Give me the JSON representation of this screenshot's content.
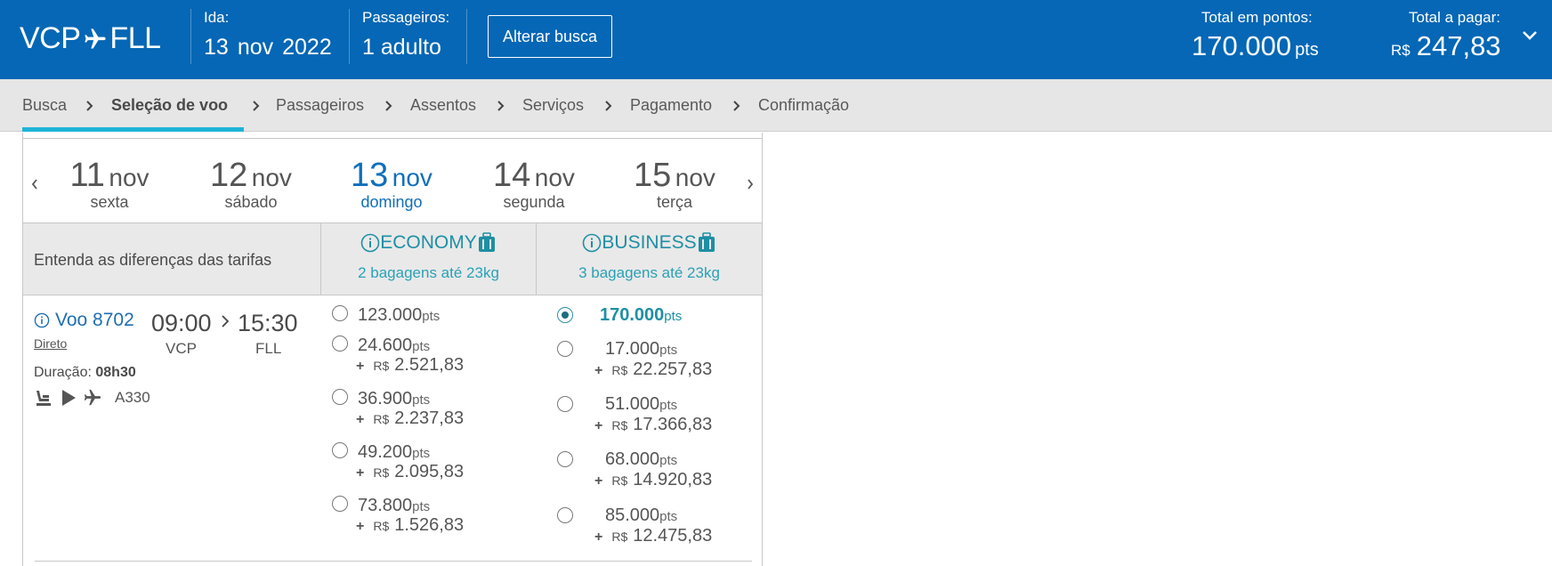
{
  "header": {
    "route_from": "VCP",
    "route_to": "FLL",
    "ida_label": "Ida:",
    "ida_day": "13",
    "ida_month": "nov",
    "ida_year": "2022",
    "passengers_label": "Passageiros:",
    "passengers_value": "1 adulto",
    "change_button": "Alterar busca",
    "total_points_label": "Total em pontos:",
    "total_points_value": "170.000",
    "total_points_unit": "pts",
    "total_pay_label": "Total a pagar:",
    "total_pay_currency": "R$",
    "total_pay_value": "247,83",
    "brand_color": "#0567b5"
  },
  "breadcrumb": {
    "steps": [
      "Busca",
      "Seleção de voo",
      "Passageiros",
      "Assentos",
      "Serviços",
      "Pagamento",
      "Confirmação"
    ],
    "active_step": "Seleção de voo"
  },
  "dates": [
    {
      "day": "11",
      "month": "nov",
      "weekday": "sexta"
    },
    {
      "day": "12",
      "month": "nov",
      "weekday": "sábado"
    },
    {
      "day": "13",
      "month": "nov",
      "weekday": "domingo",
      "selected": true
    },
    {
      "day": "14",
      "month": "nov",
      "weekday": "segunda"
    },
    {
      "day": "15",
      "month": "nov",
      "weekday": "terça"
    }
  ],
  "fare_header": {
    "differences_text": "Entenda as diferenças das tarifas",
    "economy_name": "ECONOMY",
    "economy_bags": "2 bagagens até 23kg",
    "business_name": "BUSINESS",
    "business_bags": "3 bagagens até 23kg"
  },
  "flight": {
    "number": "Voo 8702",
    "type": "Direto",
    "depart_time": "09:00",
    "arrive_time": "15:30",
    "origin": "VCP",
    "destination": "FLL",
    "duration_label": "Duração:",
    "duration_value": "08h30",
    "aircraft": "A330",
    "amenity_icons": [
      "seat-icon",
      "play-icon",
      "plane-icon"
    ]
  },
  "economy_options": [
    {
      "points": "123.000",
      "unit": "pts",
      "money": null
    },
    {
      "points": "24.600",
      "unit": "pts",
      "money": "2.521,83"
    },
    {
      "points": "36.900",
      "unit": "pts",
      "money": "2.237,83"
    },
    {
      "points": "49.200",
      "unit": "pts",
      "money": "2.095,83"
    },
    {
      "points": "73.800",
      "unit": "pts",
      "money": "1.526,83"
    }
  ],
  "business_options": [
    {
      "points": "170.000",
      "unit": "pts",
      "money": null,
      "selected": true
    },
    {
      "points": "17.000",
      "unit": "pts",
      "money": "22.257,83"
    },
    {
      "points": "51.000",
      "unit": "pts",
      "money": "17.366,83"
    },
    {
      "points": "68.000",
      "unit": "pts",
      "money": "14.920,83"
    },
    {
      "points": "85.000",
      "unit": "pts",
      "money": "12.475,83"
    }
  ],
  "money_prefix": "+",
  "money_currency": "R$"
}
